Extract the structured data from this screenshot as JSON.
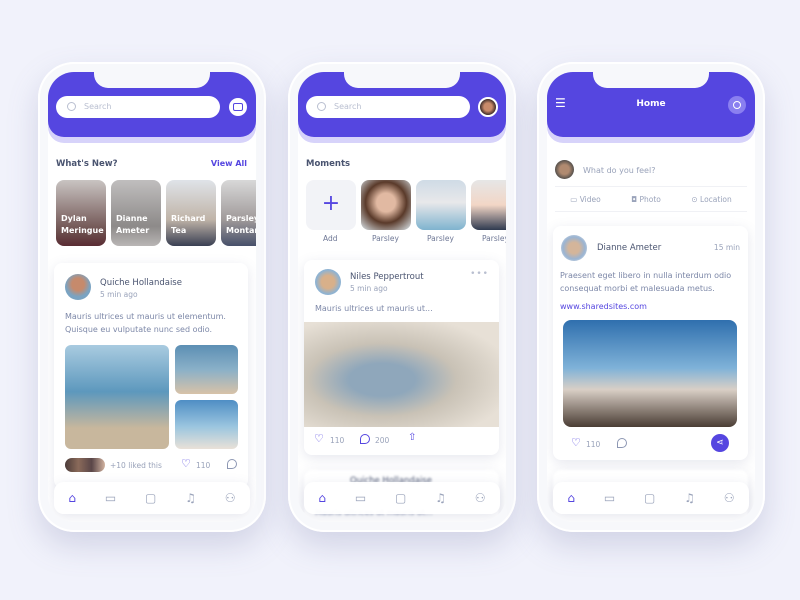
{
  "accent": "#5546e0",
  "screen1": {
    "search_placeholder": "Search",
    "section_title": "What's New?",
    "view_all": "View All",
    "stories": [
      {
        "first": "Dylan",
        "last": "Meringue"
      },
      {
        "first": "Dianne",
        "last": "Ameter"
      },
      {
        "first": "Richard",
        "last": "Tea"
      },
      {
        "first": "Parsley",
        "last": "Montana"
      }
    ],
    "post": {
      "author": "Quiche Hollandaise",
      "time": "5 min ago",
      "line1": "Mauris ultrices ut mauris ut elementum.",
      "line2": "Quisque eu vulputate nunc sed odio.",
      "liked_by": "+10 liked this",
      "likes": "110"
    }
  },
  "screen2": {
    "search_placeholder": "Search",
    "section_title": "Moments",
    "moments": [
      {
        "label": "Add"
      },
      {
        "label": "Parsley"
      },
      {
        "label": "Parsley"
      },
      {
        "label": "Parsley"
      }
    ],
    "post": {
      "author": "Niles Peppertrout",
      "time": "5 min ago",
      "text": "Mauris ultrices ut mauris ut...",
      "likes": "110",
      "comments": "200"
    },
    "post2": {
      "author": "Quiche Hollandaise",
      "text": "Mauris ultrices ut mauris ut..."
    }
  },
  "screen3": {
    "title": "Home",
    "composer_placeholder": "What do you feel?",
    "actions": [
      "Video",
      "Photo",
      "Location"
    ],
    "post": {
      "author": "Dianne Ameter",
      "time": "15 min",
      "line1": "Praesent eget libero in nulla interdum odio",
      "line2": "consequat morbi et malesuada metus.",
      "link": "www.sharedsites.com",
      "likes": "110"
    }
  },
  "nav_items": [
    "home",
    "tv",
    "chat",
    "bell",
    "profile"
  ]
}
